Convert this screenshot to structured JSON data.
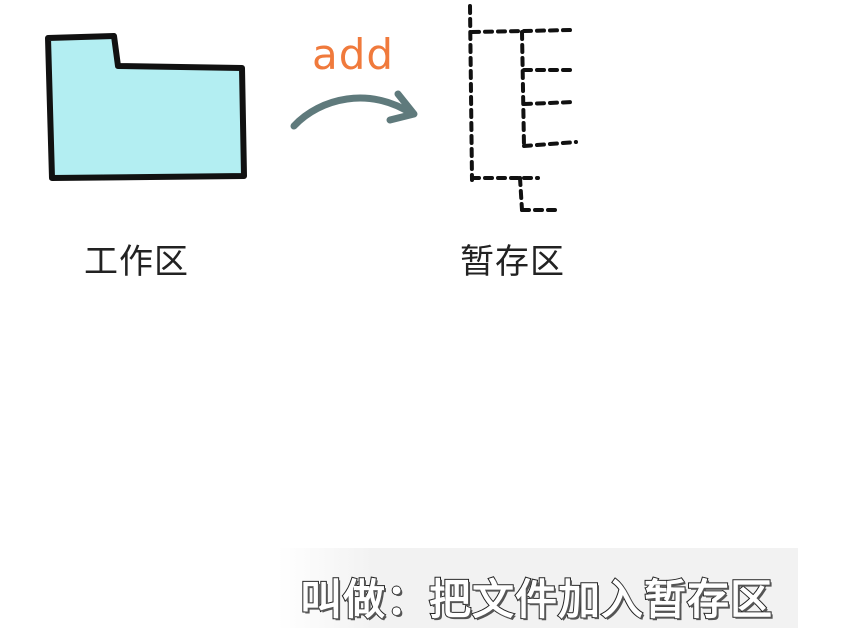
{
  "diagram": {
    "working_area_label": "工作区",
    "staging_area_label": "暂存区",
    "action_label": "add"
  },
  "subtitle": {
    "text": "叫做：把文件加入暂存区"
  },
  "colors": {
    "folder_fill": "#b3eef2",
    "outline": "#111111",
    "action_text": "#f07a3c",
    "arrow": "#5f7a7c",
    "label_text": "#222222"
  },
  "icons": {
    "working_area": "folder-icon",
    "action": "curved-arrow-icon",
    "staging_area": "tree-icon"
  }
}
